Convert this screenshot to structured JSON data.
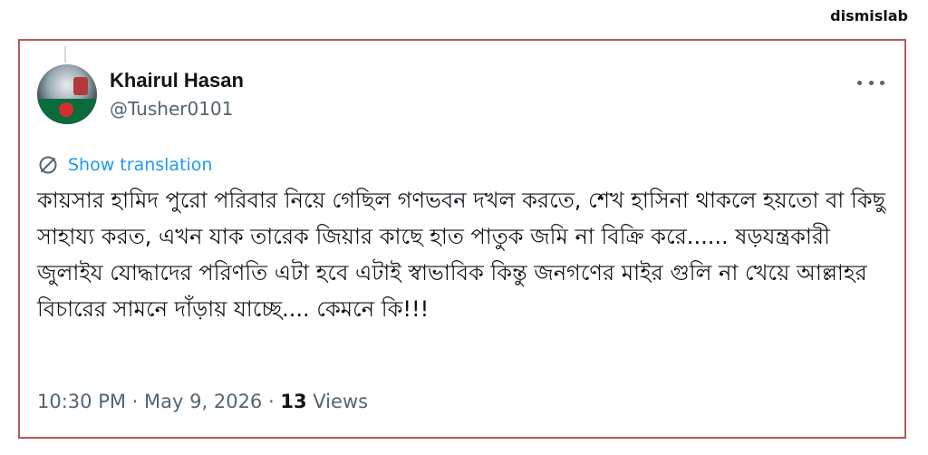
{
  "watermark": "dismislab",
  "tweet": {
    "author": {
      "display_name": "Khairul Hasan",
      "handle": "@Tusher0101"
    },
    "show_translation_label": "Show translation",
    "text": "কায়সার হামিদ পুরো পরিবার নিয়ে গেছিল গণভবন দখল করতে, শেখ হাসিনা থাকলে হয়তো বা কিছু সাহায্য করত, এখন যাক তারেক জিয়ার কাছে হাত পাতুক জমি না বিক্রি করে...... ষড়যন্ত্রকারী জুলাইয যোদ্ধাদের পরিণতি এটা হবে এটাই স্বাভাবিক কিন্তু জনগণের মাইর গুলি না খেয়ে আল্লাহর বিচারের সামনে দাঁড়ায় যাচ্ছে.... কেমনে কি!!!",
    "time": "10:30 PM",
    "date": "May 9, 2026",
    "separator": "·",
    "views_count": "13",
    "views_label": "Views"
  },
  "icons": {
    "more": "more-horizontal-icon",
    "translate": "globe-translate-icon"
  },
  "colors": {
    "link": "#1d9bf0",
    "secondary_text": "#536471",
    "primary_text": "#0f1419",
    "frame_border": "#b55a5a"
  }
}
